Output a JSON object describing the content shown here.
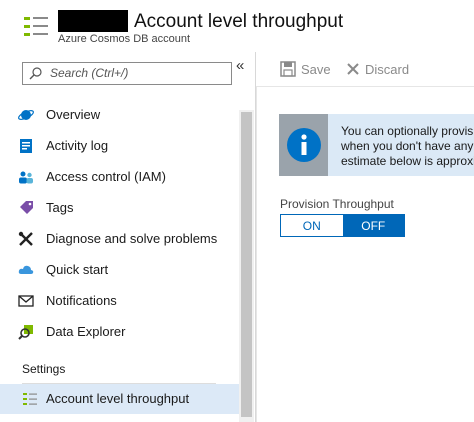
{
  "header": {
    "title": "Account level throughput",
    "subtitle": "Azure Cosmos DB account"
  },
  "sidebar": {
    "search_placeholder": "Search (Ctrl+/)",
    "collapse_glyph": "«",
    "items": [
      {
        "label": "Overview",
        "icon": "overview-icon"
      },
      {
        "label": "Activity log",
        "icon": "activity-log-icon"
      },
      {
        "label": "Access control (IAM)",
        "icon": "access-control-icon"
      },
      {
        "label": "Tags",
        "icon": "tag-icon"
      },
      {
        "label": "Diagnose and solve problems",
        "icon": "wrench-icon"
      },
      {
        "label": "Quick start",
        "icon": "cloud-icon"
      },
      {
        "label": "Notifications",
        "icon": "envelope-icon"
      },
      {
        "label": "Data Explorer",
        "icon": "data-explorer-icon"
      }
    ],
    "section_label": "Settings",
    "selected_item": {
      "label": "Account level throughput",
      "icon": "throughput-list-icon"
    }
  },
  "toolbar": {
    "save_label": "Save",
    "discard_label": "Discard"
  },
  "info_banner": {
    "lines": [
      "You can optionally provisi",
      "when you don't have any",
      "estimate below is approxi"
    ]
  },
  "provision": {
    "label": "Provision Throughput",
    "on_label": "ON",
    "off_label": "OFF",
    "selected": "OFF"
  },
  "colors": {
    "accent": "#0067b8",
    "selected_bg": "#dce9f7",
    "info_bg": "#dbe9f6",
    "info_icon_box": "#9aa3ab"
  }
}
